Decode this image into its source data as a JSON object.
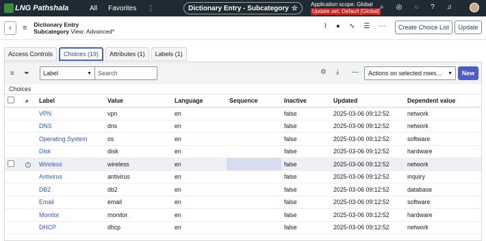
{
  "topbar": {
    "logo_text": "LNG Pathshala",
    "nav_all": "All",
    "nav_favorites": "Favorites",
    "nav_more": "⋮",
    "title": "Dictionary Entry - Subcategory",
    "scope_line": "Application scope: Global",
    "update_set": "Update set: Default [Global]"
  },
  "header": {
    "record_type": "Dictionary Entry",
    "record_name": "Subcategory",
    "view": "View: Advanced*",
    "create_choice_list": "Create Choice List",
    "update": "Update"
  },
  "tabs": [
    {
      "label": "Access Controls"
    },
    {
      "label": "Choices (19)"
    },
    {
      "label": "Attributes (1)"
    },
    {
      "label": "Labels (1)"
    }
  ],
  "toolbar": {
    "filter_select": "Label",
    "search_placeholder": "Search",
    "actions_select": "Actions on selected rows...",
    "new_button": "New"
  },
  "list_title": "Choices",
  "columns": [
    "Label",
    "Value",
    "Language",
    "Sequence",
    "Inactive",
    "Updated",
    "Dependent value"
  ],
  "rows": [
    {
      "label": "VPN",
      "value": "vpn",
      "language": "en",
      "sequence": "",
      "inactive": "false",
      "updated": "2025-03-06 09:12:52",
      "dependent": "network"
    },
    {
      "label": "DNS",
      "value": "dns",
      "language": "en",
      "sequence": "",
      "inactive": "false",
      "updated": "2025-03-06 09:12:52",
      "dependent": "network"
    },
    {
      "label": "Operating System",
      "value": "os",
      "language": "en",
      "sequence": "",
      "inactive": "false",
      "updated": "2025-03-06 09:12:52",
      "dependent": "software"
    },
    {
      "label": "Disk",
      "value": "disk",
      "language": "en",
      "sequence": "",
      "inactive": "false",
      "updated": "2025-03-06 09:12:52",
      "dependent": "hardware"
    },
    {
      "label": "Wireless",
      "value": "wireless",
      "language": "en",
      "sequence": "",
      "inactive": "false",
      "updated": "2025-03-06 09:12:52",
      "dependent": "network"
    },
    {
      "label": "Antivirus",
      "value": "antivirus",
      "language": "en",
      "sequence": "",
      "inactive": "false",
      "updated": "2025-03-06 09:12:52",
      "dependent": "inquiry"
    },
    {
      "label": "DB2",
      "value": "db2",
      "language": "en",
      "sequence": "",
      "inactive": "false",
      "updated": "2025-03-06 09:12:52",
      "dependent": "database"
    },
    {
      "label": "Email",
      "value": "email",
      "language": "en",
      "sequence": "",
      "inactive": "false",
      "updated": "2025-03-06 09:12:52",
      "dependent": "software"
    },
    {
      "label": "Monitor",
      "value": "monitor",
      "language": "en",
      "sequence": "",
      "inactive": "false",
      "updated": "2025-03-06 09:12:52",
      "dependent": "hardware"
    },
    {
      "label": "DHCP",
      "value": "dhcp",
      "language": "en",
      "sequence": "",
      "inactive": "false",
      "updated": "2025-03-06 09:12:52",
      "dependent": "network"
    }
  ],
  "colors": {
    "topbar": "#1f2b33",
    "accent": "#4a5cc8",
    "link": "#2f57c4",
    "update_set_bg": "#d41f1f"
  }
}
